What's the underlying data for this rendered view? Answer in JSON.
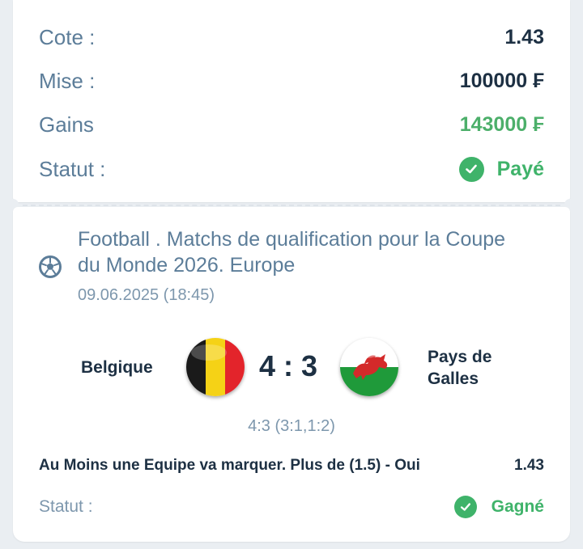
{
  "summary": {
    "odds_label": "Cote :",
    "odds_value": "1.43",
    "stake_label": "Mise :",
    "stake_value": "100000 ₣",
    "winnings_label": "Gains",
    "winnings_value": "143000 ₣",
    "status_label": "Statut :",
    "status_value": "Payé",
    "status_icon": "check-circle-icon"
  },
  "event": {
    "sport_icon": "football-icon",
    "title": "Football . Matchs de qualification pour la Coupe du Monde 2026. Europe",
    "date": "09.06.2025 (18:45)",
    "home_team": "Belgique",
    "away_team": "Pays de Galles",
    "home_flag_icon": "belgium-flag-icon",
    "away_flag_icon": "wales-flag-icon",
    "score": "4 : 3",
    "score_detail": "4:3 (3:1,1:2)"
  },
  "bet": {
    "selection": "Au Moins une Equipe va marquer. Plus de (1.5) - Oui",
    "odds": "1.43",
    "status_label": "Statut :",
    "status_value": "Gagné",
    "status_icon": "check-circle-icon"
  },
  "colors": {
    "accent_green": "#3fb36a",
    "label_blue": "#5c7d99",
    "text_dark": "#1d3043",
    "background": "#eaeef2"
  }
}
